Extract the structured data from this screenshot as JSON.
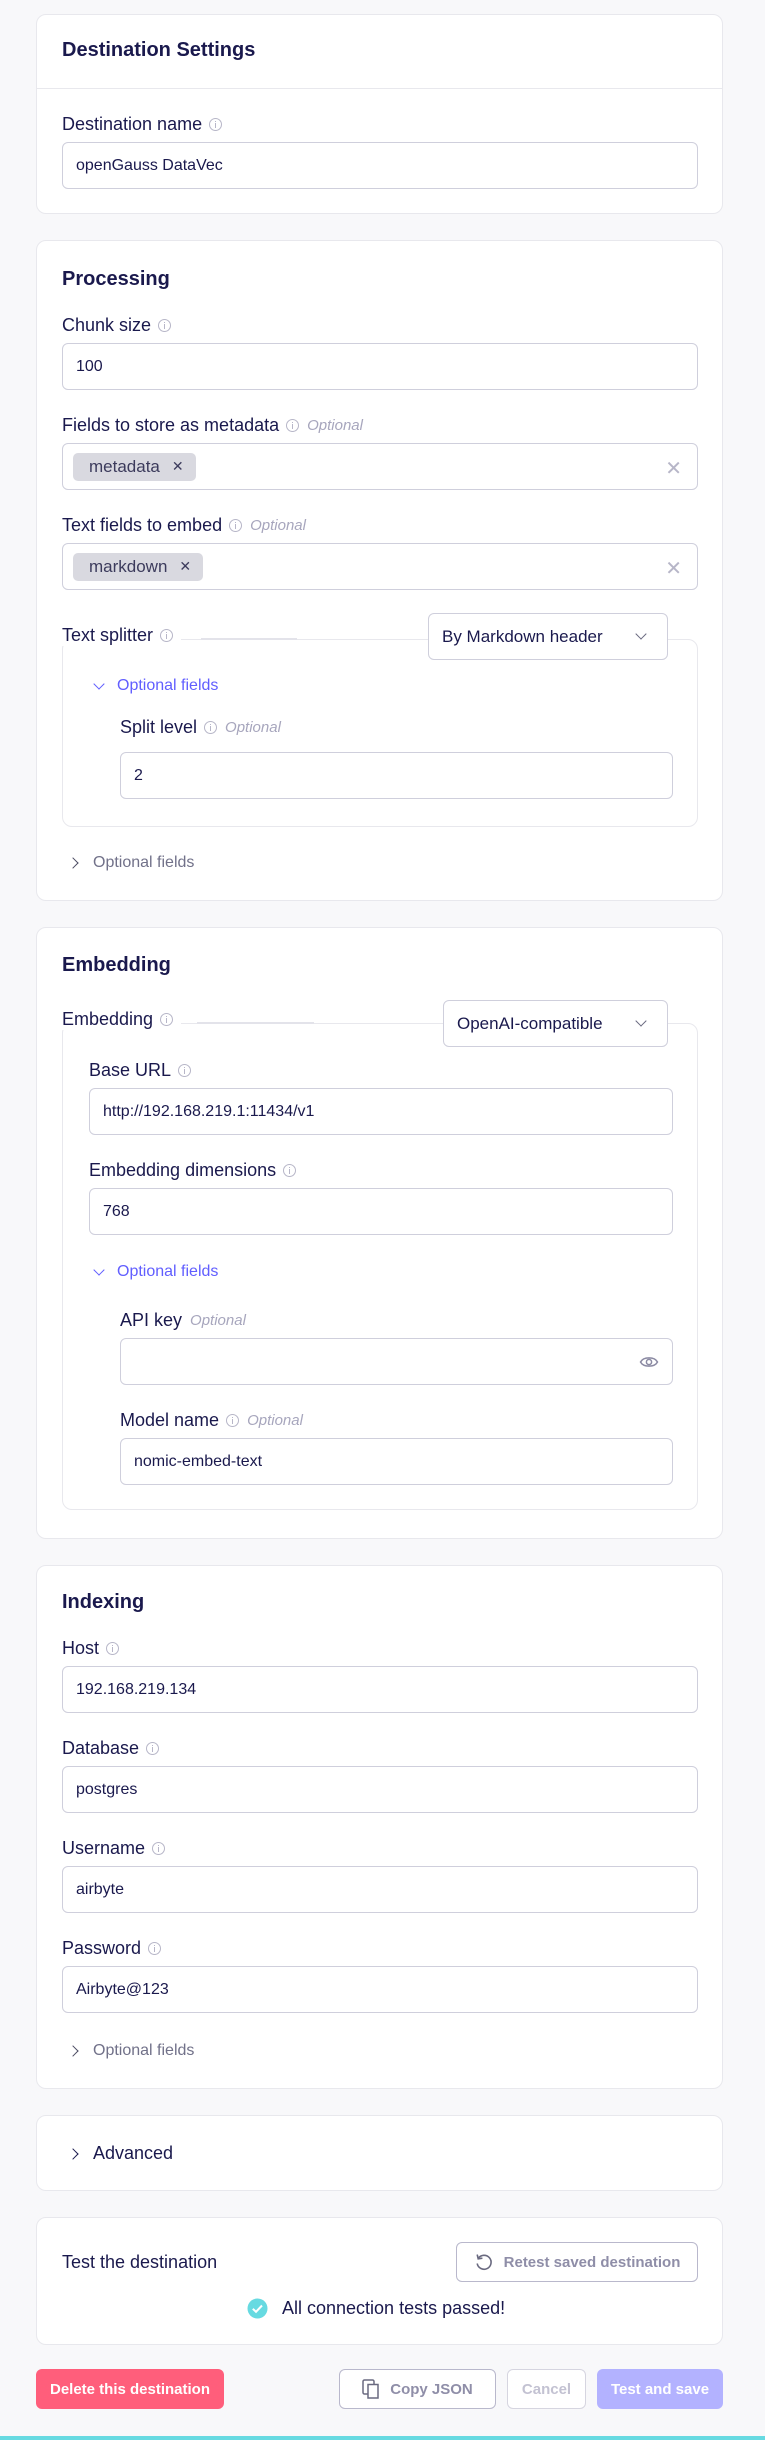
{
  "destination_settings": {
    "title": "Destination Settings",
    "name_label": "Destination name",
    "name_value": "openGauss DataVec"
  },
  "processing": {
    "title": "Processing",
    "chunk_size_label": "Chunk size",
    "chunk_size_value": "100",
    "metadata_fields_label": "Fields to store as metadata",
    "metadata_fields_optional": "Optional",
    "metadata_fields_tags": [
      "metadata"
    ],
    "embed_fields_label": "Text fields to embed",
    "embed_fields_optional": "Optional",
    "embed_fields_tags": [
      "markdown"
    ],
    "text_splitter_label": "Text splitter",
    "text_splitter_value": "By Markdown header",
    "splitter_optional_toggle": "Optional fields",
    "split_level_label": "Split level",
    "split_level_optional": "Optional",
    "split_level_value": "2",
    "optional_toggle": "Optional fields"
  },
  "embedding": {
    "title": "Embedding",
    "embedding_label": "Embedding",
    "embedding_value": "OpenAI-compatible",
    "base_url_label": "Base URL",
    "base_url_value": "http://192.168.219.1:11434/v1",
    "dimensions_label": "Embedding dimensions",
    "dimensions_value": "768",
    "optional_toggle": "Optional fields",
    "api_key_label": "API key",
    "api_key_optional": "Optional",
    "api_key_value": "",
    "model_name_label": "Model name",
    "model_name_optional": "Optional",
    "model_name_value": "nomic-embed-text"
  },
  "indexing": {
    "title": "Indexing",
    "host_label": "Host",
    "host_value": "192.168.219.134",
    "database_label": "Database",
    "database_value": "postgres",
    "username_label": "Username",
    "username_value": "airbyte",
    "password_label": "Password",
    "password_value": "Airbyte@123",
    "optional_toggle": "Optional fields"
  },
  "advanced": {
    "label": "Advanced"
  },
  "test": {
    "label": "Test the destination",
    "retest_button": "Retest saved destination",
    "status": "All connection tests passed!"
  },
  "footer": {
    "delete_button": "Delete this destination",
    "copy_json_button": "Copy JSON",
    "cancel_button": "Cancel",
    "test_save_button": "Test and save"
  },
  "colors": {
    "primary": "#615eff",
    "danger": "#ff5e7b",
    "success": "#67dae1",
    "text": "#1a194d"
  }
}
